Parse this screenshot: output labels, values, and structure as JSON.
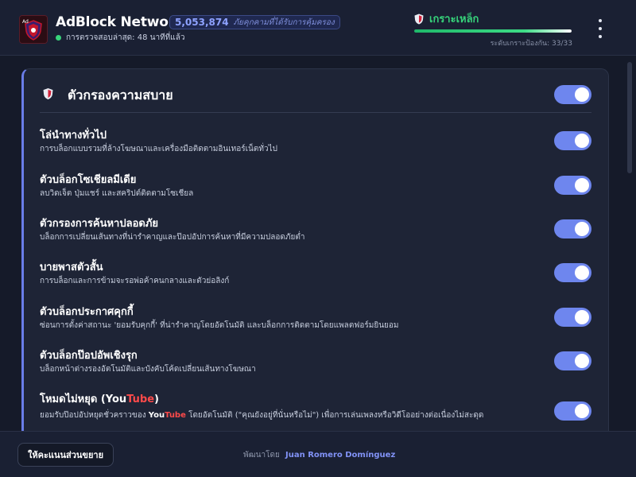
{
  "header": {
    "app_title": "AdBlock Network",
    "threat_count": "5,053,874",
    "threat_label": "ภัยคุกคามที่ได้รับการคุ้มครอง",
    "last_check": "การตรวจสอบล่าสุด: 48 นาทีที่แล้ว",
    "protection_level": "เกราะเหล็ก",
    "protection_text": "ระดับเกราะป้องกัน: 33/33",
    "protection_progress": 1.0,
    "logo_icon": "adblock-shield-logo",
    "menu_icon": "kebab-menu-icon"
  },
  "colors": {
    "accent": "#6e86ee",
    "success": "#36d27a",
    "brand_red": "#c4162c",
    "background": "#151a29",
    "card": "#1e2436"
  },
  "card": {
    "title": "ตัวกรองความสบาย",
    "master_toggle_on": true,
    "filters": [
      {
        "title": "โล่นำทางทั่วไป",
        "description": "การบล็อกแบบรวมที่ล้างโฆษณาและเครื่องมือติดตามอินเทอร์เน็ตทั่วไป",
        "enabled": true
      },
      {
        "title": "ตัวบล็อกโซเชียลมีเดีย",
        "description": "ลบวิดเจ็ต ปุ่มแชร์ และสคริปต์ติดตามโซเชียล",
        "enabled": true
      },
      {
        "title": "ตัวกรองการค้นหาปลอดภัย",
        "description": "บล็อกการเปลี่ยนเส้นทางที่น่ารำคาญและป๊อปอัปการค้นหาที่มีความปลอดภัยต่ำ",
        "enabled": true
      },
      {
        "title": "บายพาสตัวสั้น",
        "description": "การบล็อกและการข้ามจะรอพ่อค้าคนกลางและตัวย่อลิงก์",
        "enabled": true
      },
      {
        "title": "ตัวบล็อกประกาศคุกกี้",
        "description": "ซ่อนการตั้งค่าสถานะ 'ยอมรับคุกกี้' ที่น่ารำคาญโดยอัตโนมัติ และบล็อกการติดตามโดยแพลตฟอร์มยินยอม",
        "enabled": true
      },
      {
        "title": "ตัวบล็อกป๊อปอัพเชิงรุก",
        "description": "บล็อกหน้าต่างรองอัตโนมัติและบังคับโค้ดเปลี่ยนเส้นทางโฆษณา",
        "enabled": true
      }
    ],
    "youtube_filter": {
      "title_prefix": "โหมดไม่หยุด (",
      "title_you": "You",
      "title_tube": "Tube",
      "title_suffix": ")",
      "desc_part1": "ยอมรับป๊อปอัปหยุดชั่วคราวของ ",
      "desc_you": "You",
      "desc_tube": "Tube",
      "desc_part2": " โดยอัตโนมัติ (\"คุณยังอยู่ที่นั่นหรือไม่\") เพื่อการเล่นเพลงหรือวิดีโออย่างต่อเนื่องไม่สะดุด",
      "enabled": true
    }
  },
  "footer": {
    "rate_button": "ให้คะแนนส่วนขยาย",
    "developed_by": "พัฒนาโดย",
    "author": "Juan Romero Domínguez"
  }
}
